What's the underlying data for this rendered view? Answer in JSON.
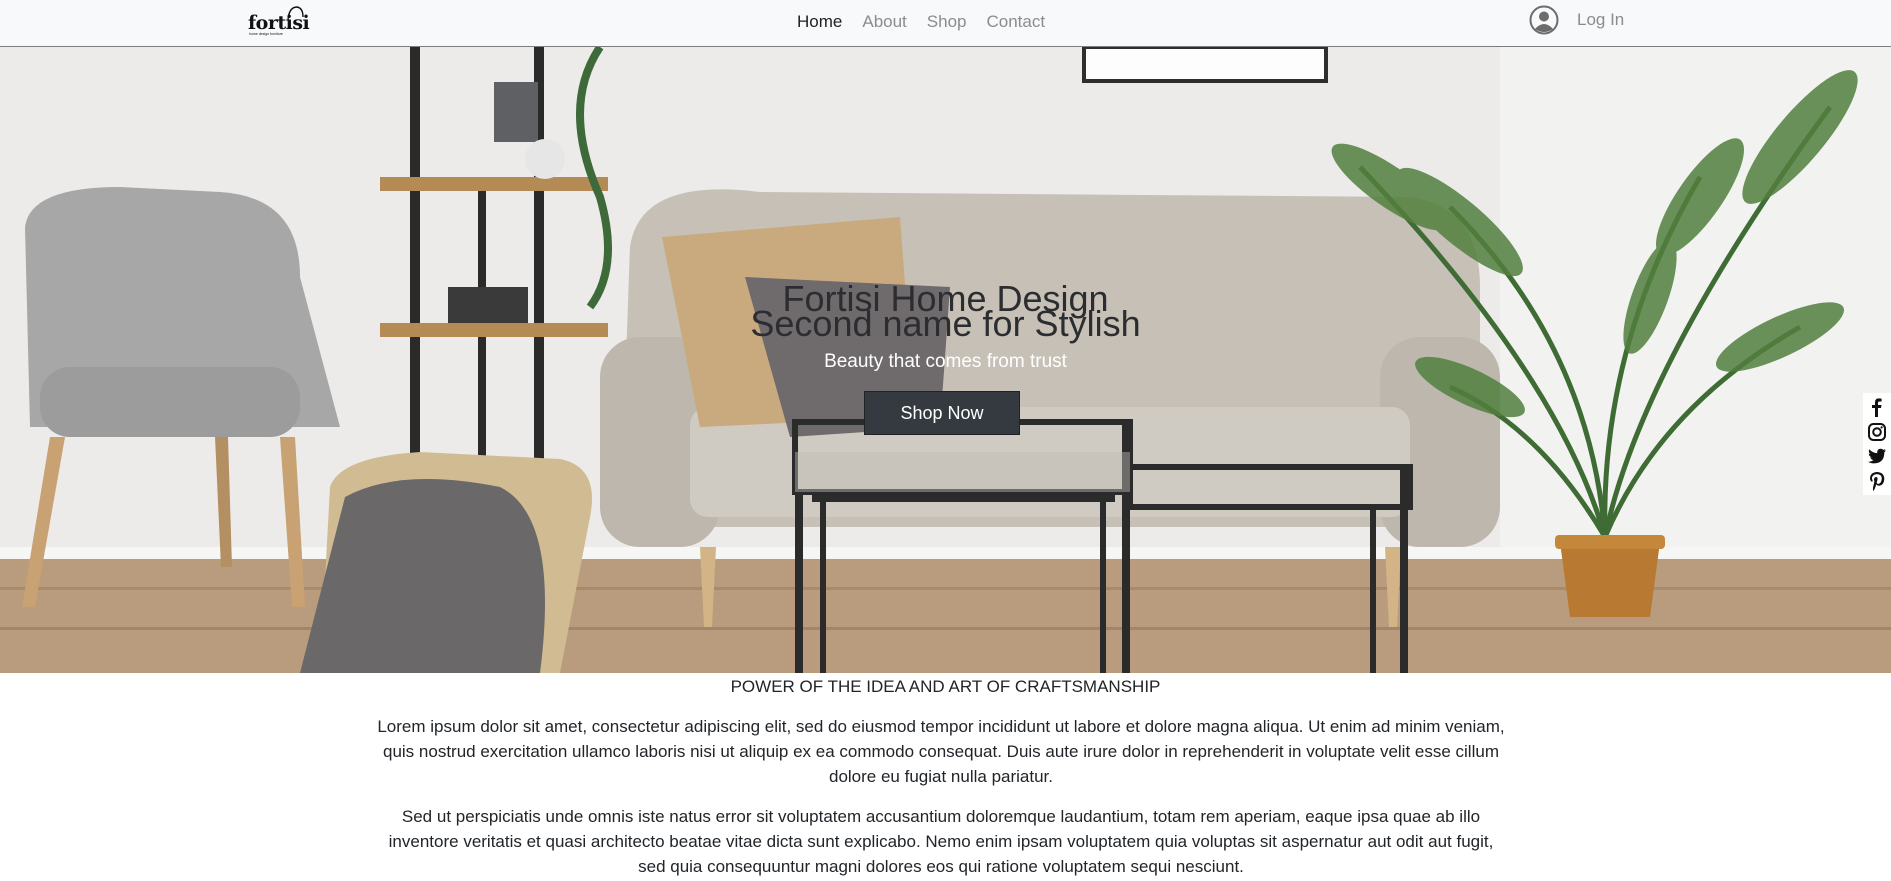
{
  "brand": {
    "logo_text": "fortisi",
    "logo_subtext": "home design furniture"
  },
  "nav": {
    "links": [
      {
        "label": "Home",
        "active": true
      },
      {
        "label": "About",
        "active": false
      },
      {
        "label": "Shop",
        "active": false
      },
      {
        "label": "Contact",
        "active": false
      }
    ],
    "login_label": "Log In"
  },
  "hero": {
    "title_line1": "Fortisi Home Design",
    "title_line2": "Second name for Stylish",
    "subtitle": "Beauty that comes from trust",
    "cta_label": "Shop Now"
  },
  "social": [
    "facebook-icon",
    "instagram-icon",
    "twitter-icon",
    "pinterest-icon"
  ],
  "content": {
    "heading": "POWER OF THE IDEA AND ART OF CRAFTSMANSHIP",
    "paragraph1": "Lorem ipsum dolor sit amet, consectetur adipiscing elit, sed do eiusmod tempor incididunt ut labore et dolore magna aliqua. Ut enim ad minim veniam, quis nostrud exercitation ullamco laboris nisi ut aliquip ex ea commodo consequat. Duis aute irure dolor in reprehenderit in voluptate velit esse cillum dolore eu fugiat nulla pariatur.",
    "paragraph2": "Sed ut perspiciatis unde omnis iste natus error sit voluptatem accusantium doloremque laudantium, totam rem aperiam, eaque ipsa quae ab illo inventore veritatis et quasi architecto beatae vitae dicta sunt explicabo. Nemo enim ipsam voluptatem quia voluptas sit aspernatur aut odit aut fugit, sed quia consequuntur magni dolores eos qui ratione voluptatem sequi nesciunt."
  },
  "colors": {
    "navbar_bg": "#f8f9fa",
    "button_bg": "#343a40",
    "text": "#212529",
    "muted": "#8c8c8c"
  }
}
